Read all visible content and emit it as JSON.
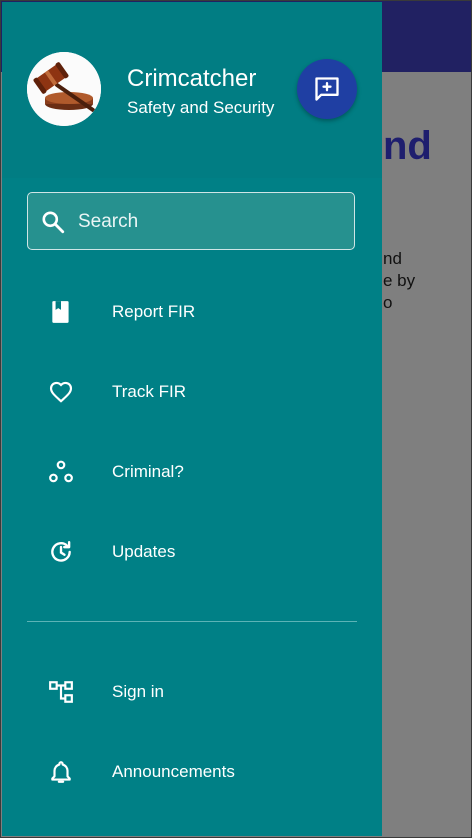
{
  "header": {
    "title": "Crimcatcher",
    "subtitle": "Safety and Security",
    "avatar_icon": "gavel-icon",
    "action_icon": "add-comment-icon"
  },
  "search": {
    "placeholder": "Search",
    "value": ""
  },
  "menu": {
    "primary": [
      {
        "label": "Report FIR",
        "icon": "book-icon"
      },
      {
        "label": "Track FIR",
        "icon": "heart-icon"
      },
      {
        "label": "Criminal?",
        "icon": "bubble-chart-icon"
      },
      {
        "label": "Updates",
        "icon": "update-icon"
      }
    ],
    "secondary": [
      {
        "label": "Sign in",
        "icon": "account-tree-icon"
      },
      {
        "label": "Announcements",
        "icon": "bell-icon"
      }
    ]
  },
  "background": {
    "heading_fragment": "nd",
    "text_fragments": [
      "nd",
      "e by",
      "o"
    ]
  },
  "colors": {
    "drawer": "#008086",
    "fab": "#1f3fa3",
    "appbar": "#212162",
    "scrim": "#7f7f7f"
  }
}
